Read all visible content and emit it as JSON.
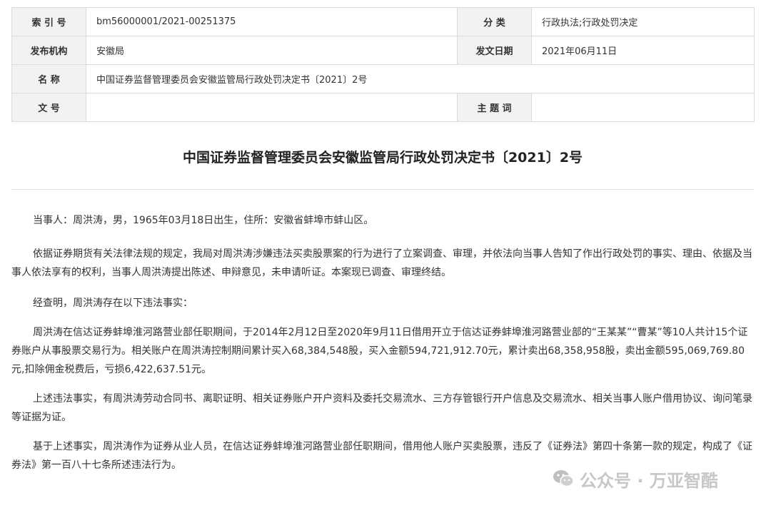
{
  "meta": {
    "index_no_label": "索 引 号",
    "index_no_value": "bm56000001/2021-00251375",
    "category_label": "分 类",
    "category_value": "行政执法;行政处罚决定",
    "issuer_label": "发布机构",
    "issuer_value": "安徽局",
    "date_label": "发文日期",
    "date_value": "2021年06月11日",
    "name_label": "名 称",
    "name_value": "中国证券监督管理委员会安徽监管局行政处罚决定书〔2021〕2号",
    "doc_no_label": "文 号",
    "doc_no_value": "",
    "keywords_label": "主 题 词",
    "keywords_value": ""
  },
  "doc": {
    "title": "中国证券监督管理委员会安徽监管局行政处罚决定书〔2021〕2号",
    "paragraphs": [
      "当事人：周洪涛，男，1965年03月18日出生，住所：安徽省蚌埠市蚌山区。",
      "依据证券期货有关法律法规的规定，我局对周洪涛涉嫌违法买卖股票案的行为进行了立案调查、审理，并依法向当事人告知了作出行政处罚的事实、理由、依据及当事人依法享有的权利，当事人周洪涛提出陈述、申辩意见，未申请听证。本案现已调查、审理终结。",
      "经查明，周洪涛存在以下违法事实：",
      "周洪涛在信达证券蚌埠淮河路营业部任职期间，于2014年2月12日至2020年9月11日借用开立于信达证券蚌埠淮河路营业部的“王某某”“曹某”等10人共计15个证券账户从事股票交易行为。相关账户在周洪涛控制期间累计买入68,384,548股，买入金额594,721,912.70元，累计卖出68,358,958股，卖出金额595,069,769.80元,扣除佣金税费后，亏损6,422,637.51元。",
      "上述违法事实，有周洪涛劳动合同书、离职证明、相关证券账户开户资料及委托交易流水、三方存管银行开户信息及交易流水、相关当事人账户借用协议、询问笔录等证据为证。",
      "基于上述事实，周洪涛作为证券从业人员，在信达证券蚌埠淮河路营业部任职期间，借用他人账户买卖股票，违反了《证券法》第四十条第一款的规定，构成了《证券法》第一百八十七条所述违法行为。"
    ]
  },
  "watermark": {
    "text": "公众号 · 万亚智酷",
    "icon": "wechat-icon"
  }
}
